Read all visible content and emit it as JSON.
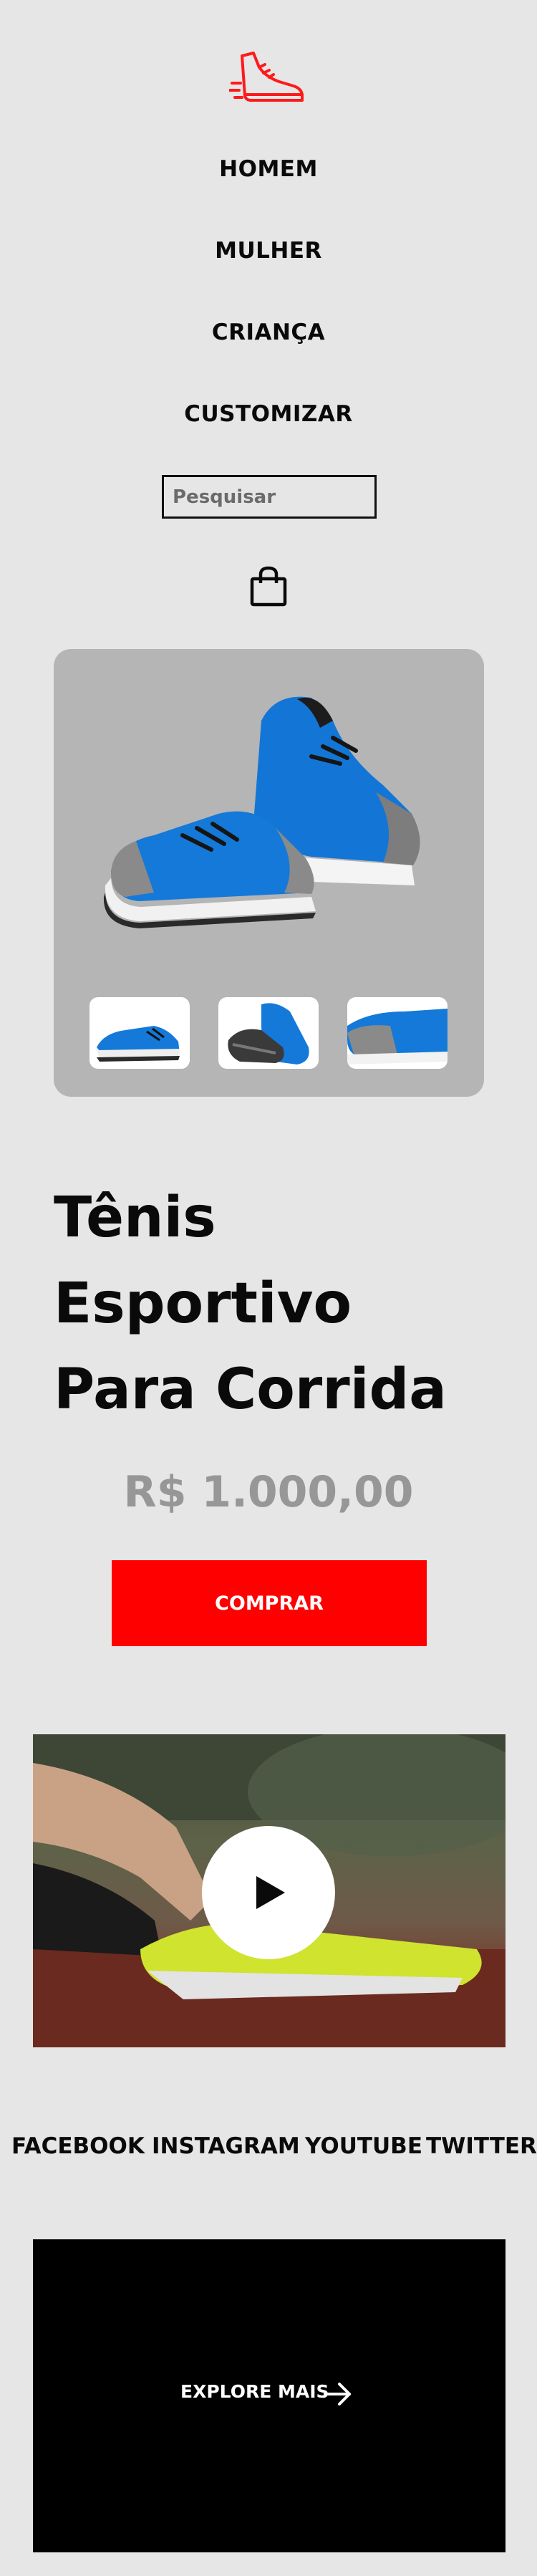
{
  "header": {
    "logo_icon": "sneaker-logo-icon",
    "logo_color": "#ff1a1a"
  },
  "nav": {
    "items": [
      {
        "label": "HOMEM"
      },
      {
        "label": "MULHER"
      },
      {
        "label": "CRIANÇA"
      },
      {
        "label": "CUSTOMIZAR"
      }
    ]
  },
  "search": {
    "placeholder": "Pesquisar",
    "value": ""
  },
  "cart": {
    "icon": "shopping-bag-icon"
  },
  "product": {
    "title": "Tênis Esportivo Para Corrida",
    "price": "R$ 1.000,00",
    "buy_label": "COMPRAR",
    "buy_color": "#ff0000",
    "thumbnails": [
      "shoe-pair-side",
      "shoe-pair-sole",
      "shoe-heel-closeup"
    ]
  },
  "video": {
    "play_icon": "play-icon"
  },
  "social": {
    "links": [
      {
        "label": "FACEBOOK"
      },
      {
        "label": "INSTAGRAM"
      },
      {
        "label": "YOUTUBE"
      },
      {
        "label": "TWITTER"
      }
    ]
  },
  "explore": {
    "label": "EXPLORE MAIS",
    "icon": "arrow-right-icon"
  }
}
